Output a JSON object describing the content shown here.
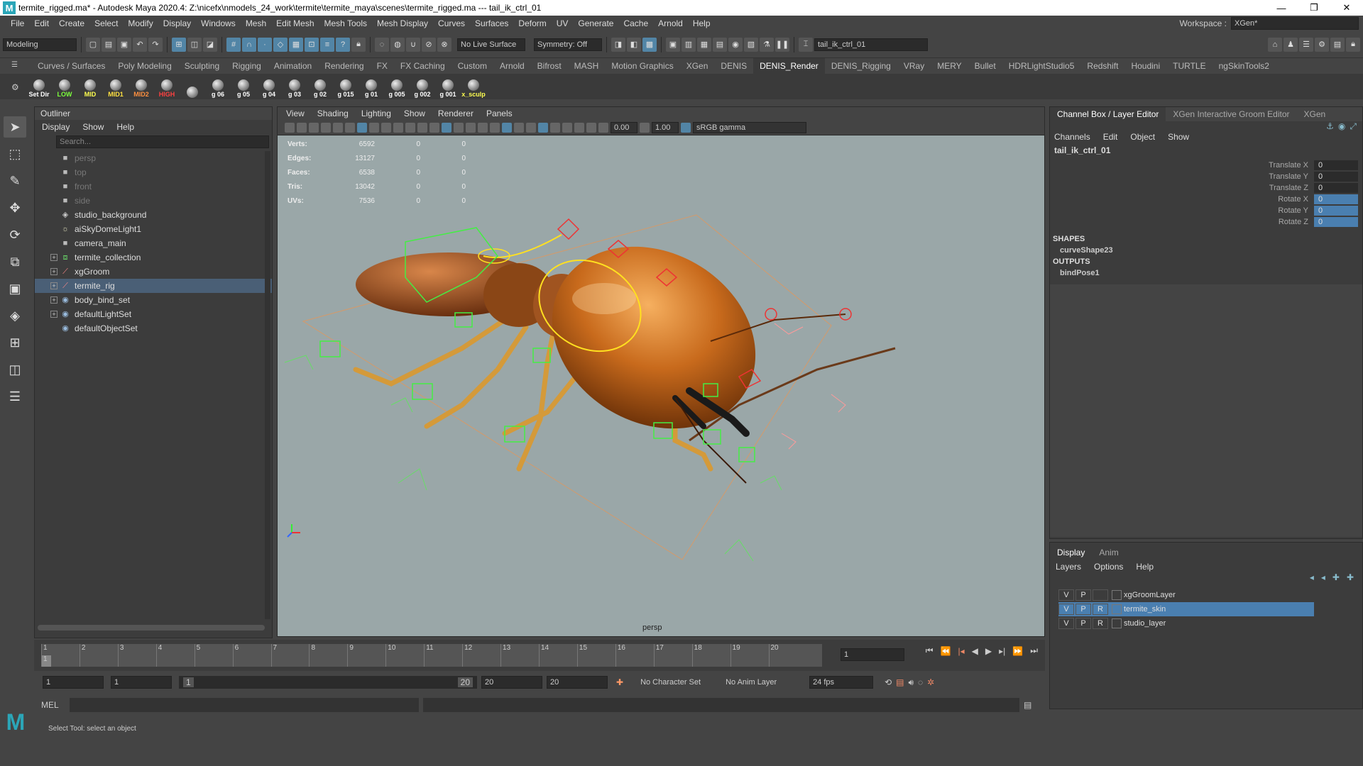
{
  "window": {
    "title": "termite_rigged.ma* - Autodesk Maya 2020.4: Z:\\nicefx\\nmodels_24_work\\termite\\termite_maya\\scenes\\termite_rigged.ma  ---  tail_ik_ctrl_01",
    "minimize": "—",
    "restore": "❐",
    "close": "✕"
  },
  "menubar": {
    "items": [
      "File",
      "Edit",
      "Create",
      "Select",
      "Modify",
      "Display",
      "Windows",
      "Mesh",
      "Edit Mesh",
      "Mesh Tools",
      "Mesh Display",
      "Curves",
      "Surfaces",
      "Deform",
      "UV",
      "Generate",
      "Cache",
      "Arnold",
      "Help"
    ],
    "workspace_label": "Workspace :",
    "workspace_value": "XGen*"
  },
  "statusline": {
    "menuset": "Modeling",
    "live_surface": "No Live Surface",
    "symmetry": "Symmetry: Off",
    "object_name": "tail_ik_ctrl_01"
  },
  "shelf": {
    "tabs": [
      "Curves / Surfaces",
      "Poly Modeling",
      "Sculpting",
      "Rigging",
      "Animation",
      "Rendering",
      "FX",
      "FX Caching",
      "Custom",
      "Arnold",
      "Bifrost",
      "MASH",
      "Motion Graphics",
      "XGen",
      "DENIS",
      "DENIS_Render",
      "DENIS_Rigging",
      "VRay",
      "MERY",
      "Bullet",
      "HDRLightStudio5",
      "Redshift",
      "Houdini",
      "TURTLE",
      "ngSkinTools2"
    ],
    "active_tab": "DENIS_Render",
    "buttons": [
      "Set Dir",
      "LOW",
      "MID",
      "MID1",
      "MID2",
      "HIGH",
      "",
      "g 06",
      "g 05",
      "g 04",
      "g 03",
      "g 02",
      "g 015",
      "g 01",
      "g 005",
      "g 002",
      "g 001",
      "x_sculp"
    ],
    "button_colors": [
      "#ffffff",
      "#7cff3c",
      "#ffff50",
      "#ffe040",
      "#ff9040",
      "#ff4040",
      "#ffffff",
      "#ffffff",
      "#ffffff",
      "#ffffff",
      "#ffffff",
      "#ffffff",
      "#ffffff",
      "#ffffff",
      "#ffffff",
      "#ffffff",
      "#ffffff",
      "#ffff50"
    ]
  },
  "outliner": {
    "title": "Outliner",
    "menu": [
      "Display",
      "Show",
      "Help"
    ],
    "search_placeholder": "Search...",
    "items": [
      {
        "label": "persp",
        "icon": "camera-icon",
        "dim": true,
        "expand": false
      },
      {
        "label": "top",
        "icon": "camera-icon",
        "dim": true,
        "expand": false
      },
      {
        "label": "front",
        "icon": "camera-icon",
        "dim": true,
        "expand": false
      },
      {
        "label": "side",
        "icon": "camera-icon",
        "dim": true,
        "expand": false
      },
      {
        "label": "studio_background",
        "icon": "mesh-icon",
        "dim": false,
        "expand": false
      },
      {
        "label": "aiSkyDomeLight1",
        "icon": "light-icon",
        "dim": false,
        "expand": false
      },
      {
        "label": "camera_main",
        "icon": "camera-icon",
        "dim": false,
        "expand": false
      },
      {
        "label": "termite_collection",
        "icon": "group-icon",
        "dim": false,
        "expand": true
      },
      {
        "label": "xgGroom",
        "icon": "curve-icon",
        "dim": false,
        "expand": true
      },
      {
        "label": "termite_rig",
        "icon": "curve-icon",
        "dim": false,
        "expand": true,
        "selected": true
      },
      {
        "label": "body_bind_set",
        "icon": "set-icon",
        "dim": false,
        "expand": true
      },
      {
        "label": "defaultLightSet",
        "icon": "set-icon",
        "dim": false,
        "expand": true
      },
      {
        "label": "defaultObjectSet",
        "icon": "set-icon",
        "dim": false,
        "expand": false
      }
    ]
  },
  "viewport": {
    "menu": [
      "View",
      "Shading",
      "Lighting",
      "Show",
      "Renderer",
      "Panels"
    ],
    "exposure": "0.00",
    "gamma": "1.00",
    "color_space": "sRGB gamma",
    "camera": "persp",
    "hud": [
      {
        "k": "Verts:",
        "a": "6592",
        "b": "0",
        "c": "0"
      },
      {
        "k": "Edges:",
        "a": "13127",
        "b": "0",
        "c": "0"
      },
      {
        "k": "Faces:",
        "a": "6538",
        "b": "0",
        "c": "0"
      },
      {
        "k": "Tris:",
        "a": "13042",
        "b": "0",
        "c": "0"
      },
      {
        "k": "UVs:",
        "a": "7536",
        "b": "0",
        "c": "0"
      }
    ]
  },
  "channelbox": {
    "tabs": [
      "Channel Box / Layer Editor",
      "XGen Interactive Groom Editor",
      "XGen"
    ],
    "menu": [
      "Channels",
      "Edit",
      "Object",
      "Show"
    ],
    "object": "tail_ik_ctrl_01",
    "attrs": [
      {
        "n": "Translate X",
        "v": "0",
        "key": false
      },
      {
        "n": "Translate Y",
        "v": "0",
        "key": false
      },
      {
        "n": "Translate Z",
        "v": "0",
        "key": false
      },
      {
        "n": "Rotate X",
        "v": "0",
        "key": true
      },
      {
        "n": "Rotate Y",
        "v": "0",
        "key": true
      },
      {
        "n": "Rotate Z",
        "v": "0",
        "key": true
      }
    ],
    "shapes_label": "SHAPES",
    "shape": "curveShape23",
    "outputs_label": "OUTPUTS",
    "output": "bindPose1"
  },
  "layers": {
    "tabs": [
      "Display",
      "Anim"
    ],
    "menu": [
      "Layers",
      "Options",
      "Help"
    ],
    "rows": [
      {
        "v": "V",
        "p": "P",
        "r": "",
        "name": "xgGroomLayer",
        "selected": false
      },
      {
        "v": "V",
        "p": "P",
        "r": "R",
        "name": "termite_skin",
        "selected": true
      },
      {
        "v": "V",
        "p": "P",
        "r": "R",
        "name": "studio_layer",
        "selected": false
      }
    ]
  },
  "timeline": {
    "ticks": [
      "1",
      "2",
      "3",
      "4",
      "5",
      "6",
      "7",
      "8",
      "9",
      "10",
      "11",
      "12",
      "13",
      "14",
      "15",
      "16",
      "17",
      "18",
      "19",
      "20"
    ],
    "current_frame": "1",
    "current": "1"
  },
  "range": {
    "start": "1",
    "anim_start": "1",
    "slider_start": "1",
    "slider_end": "20",
    "end": "20",
    "anim_end": "20",
    "char_set": "No Character Set",
    "anim_layer": "No Anim Layer",
    "fps": "24 fps"
  },
  "cmd": {
    "label": "MEL"
  },
  "help": {
    "text": "Select Tool: select an object"
  }
}
